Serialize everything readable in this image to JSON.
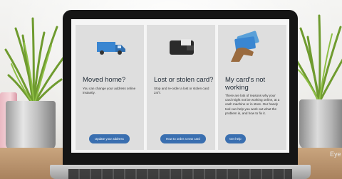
{
  "cards": [
    {
      "title": "Moved home?",
      "body": "You can change your address online instantly.",
      "button": "Update your address",
      "icon": "truck-icon"
    },
    {
      "title": "Lost or stolen card?",
      "body": "Stop and re-order a lost or stolen card 24/7.",
      "button": "How to order a new card",
      "icon": "wallet-icon"
    },
    {
      "title": "My card's not working",
      "body": "There are lots of reasons why your card might not be working online, at a cash machine or in store. Our handy tool can help you work out what the problem is, and how to fix it.",
      "button": "Get help",
      "icon": "hand-cards-icon"
    }
  ],
  "watermark": "Eye",
  "colors": {
    "button": "#3a6fb0",
    "card_bg": "#dedede",
    "bezel": "#151515"
  }
}
